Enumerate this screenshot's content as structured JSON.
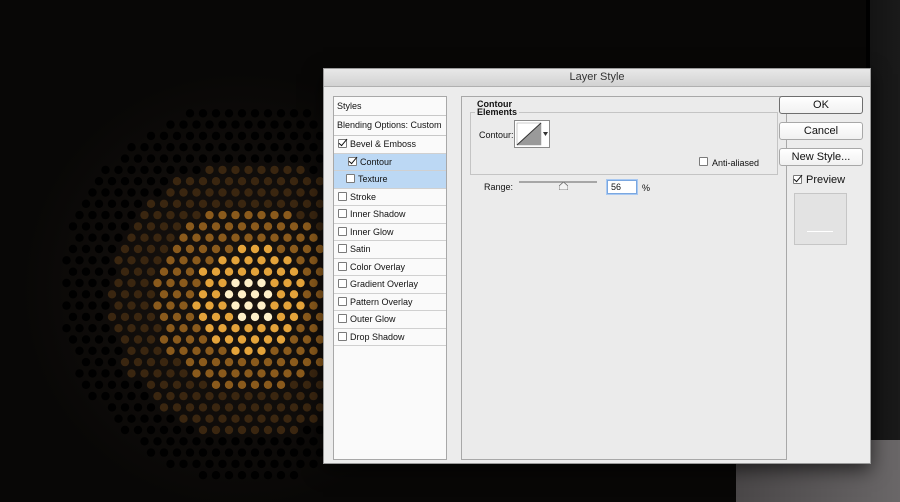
{
  "dialog": {
    "title": "Layer Style"
  },
  "styles": {
    "header": "Styles",
    "blending_options": "Blending Options: Custom",
    "items": [
      {
        "label": "Bevel & Emboss",
        "checked": true
      },
      {
        "label": "Contour",
        "checked": true,
        "selected": true
      },
      {
        "label": "Texture",
        "checked": false,
        "selected": true
      },
      {
        "label": "Stroke",
        "checked": false
      },
      {
        "label": "Inner Shadow",
        "checked": false
      },
      {
        "label": "Inner Glow",
        "checked": false
      },
      {
        "label": "Satin",
        "checked": false
      },
      {
        "label": "Color Overlay",
        "checked": false
      },
      {
        "label": "Gradient Overlay",
        "checked": false
      },
      {
        "label": "Pattern Overlay",
        "checked": false
      },
      {
        "label": "Outer Glow",
        "checked": false
      },
      {
        "label": "Drop Shadow",
        "checked": false
      }
    ]
  },
  "contour_section": {
    "title": "Contour",
    "elements_title": "Elements",
    "contour_label": "Contour:",
    "anti_aliased_label": "Anti-aliased",
    "anti_aliased_checked": false,
    "range_label": "Range:",
    "range_value": "56",
    "range_unit": "%"
  },
  "buttons": {
    "ok": "OK",
    "cancel": "Cancel",
    "new_style": "New Style...",
    "preview_label": "Preview",
    "preview_checked": true
  }
}
